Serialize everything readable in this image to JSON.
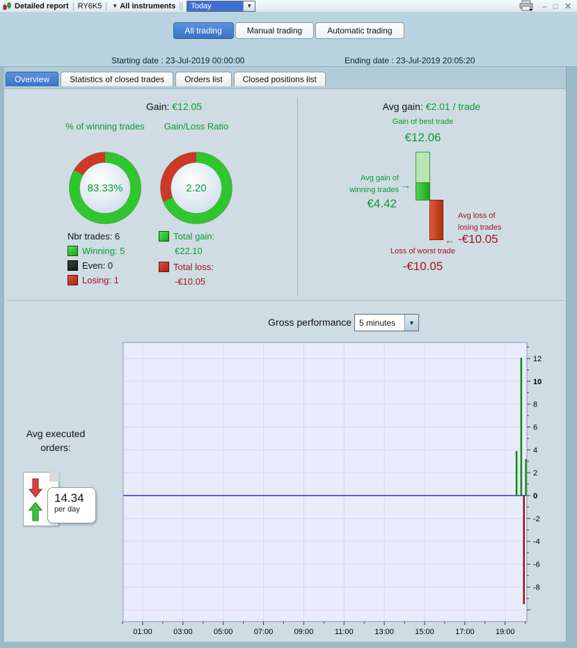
{
  "colors": {
    "accent_blue": "#3f6fd0",
    "green_text": "#089a33",
    "red_text": "#a51222",
    "donut_green": "#2ec82e",
    "donut_red": "#cc3a26",
    "chart_bg": "#e9ecfa",
    "chart_zero_line": "#2233cc",
    "bar_green": "#0a8a0a",
    "bar_red": "#991111"
  },
  "titlebar": {
    "app_icon": "candlestick-icon",
    "title": "Detailed report",
    "instrument": "RY6K5",
    "instruments_dropdown": "All instruments",
    "period_value": "Today",
    "printer_icon": "printer-icon",
    "minimize": "–",
    "maximize": "□",
    "close": "✕"
  },
  "mode_tabs": {
    "items": [
      {
        "label": "All trading",
        "active": true
      },
      {
        "label": "Manual trading",
        "active": false
      },
      {
        "label": "Automatic trading",
        "active": false
      }
    ]
  },
  "dates": {
    "starting": "Starting date :  23-Jul-2019 00:00:00",
    "ending": "Ending date :  23-Jul-2019 20:05:20"
  },
  "report_tabs": {
    "items": [
      {
        "label": "Overview",
        "active": true
      },
      {
        "label": "Statistics of closed trades",
        "active": false
      },
      {
        "label": "Orders list",
        "active": false
      },
      {
        "label": "Closed positions list",
        "active": false
      }
    ]
  },
  "overview": {
    "gain_label": "Gain:",
    "gain_value": "€12.05",
    "winning_donut": {
      "title": "% of winning trades",
      "center": "83.33%",
      "green_pct": 83.33
    },
    "ratio_donut": {
      "title": "Gain/Loss Ratio",
      "center": "2.20",
      "green_pct": 68.75
    },
    "trades": {
      "total": "Nbr trades: 6",
      "winning": "Winning: 5",
      "even": "Even: 0",
      "losing": "Losing: 1"
    },
    "totals": {
      "gain_label": "Total gain:",
      "gain_value": "€22.10",
      "loss_label": "Total loss:",
      "loss_value": "-€10.05"
    },
    "avg_panel": {
      "avg_label": "Avg gain:",
      "avg_value": "€2.01 / trade",
      "best_label": "Gain of best trade",
      "best_value": "€12.06",
      "avg_win_label": "Avg gain of winning trades",
      "avg_win_value": "€4.42",
      "avg_loss_label": "Avg loss of losing trades",
      "avg_loss_value": "-€10.05",
      "worst_label": "Loss of worst trade",
      "worst_value": "-€10.05"
    }
  },
  "gross_performance": {
    "title": "Gross performance",
    "interval_value": "5 minutes"
  },
  "avg_orders": {
    "label": "Avg executed orders:",
    "value": "14.34",
    "unit": "per day"
  },
  "chart_data": {
    "type": "bar",
    "title": "Gross performance (5 minutes)",
    "x_tick_labels": [
      "01:00",
      "03:00",
      "05:00",
      "07:00",
      "09:00",
      "11:00",
      "13:00",
      "15:00",
      "17:00",
      "19:00"
    ],
    "x_label_hours": [
      1,
      3,
      5,
      7,
      9,
      11,
      13,
      15,
      17,
      19
    ],
    "y_tick_labels": [
      12,
      10,
      8,
      6,
      4,
      2,
      0,
      -2,
      -4,
      -6,
      -8
    ],
    "y_bold_ticks": [
      10,
      0
    ],
    "ylim": [
      -11,
      13.4
    ],
    "xlim_hours": [
      0,
      20.08
    ],
    "grid": true,
    "zero_line": true,
    "bars": [
      {
        "time": "19:34",
        "value": 3.9
      },
      {
        "time": "19:48",
        "value": 12.06
      },
      {
        "time": "19:56",
        "value": -9.5
      },
      {
        "time": "20:02",
        "value": 3.2
      }
    ]
  }
}
